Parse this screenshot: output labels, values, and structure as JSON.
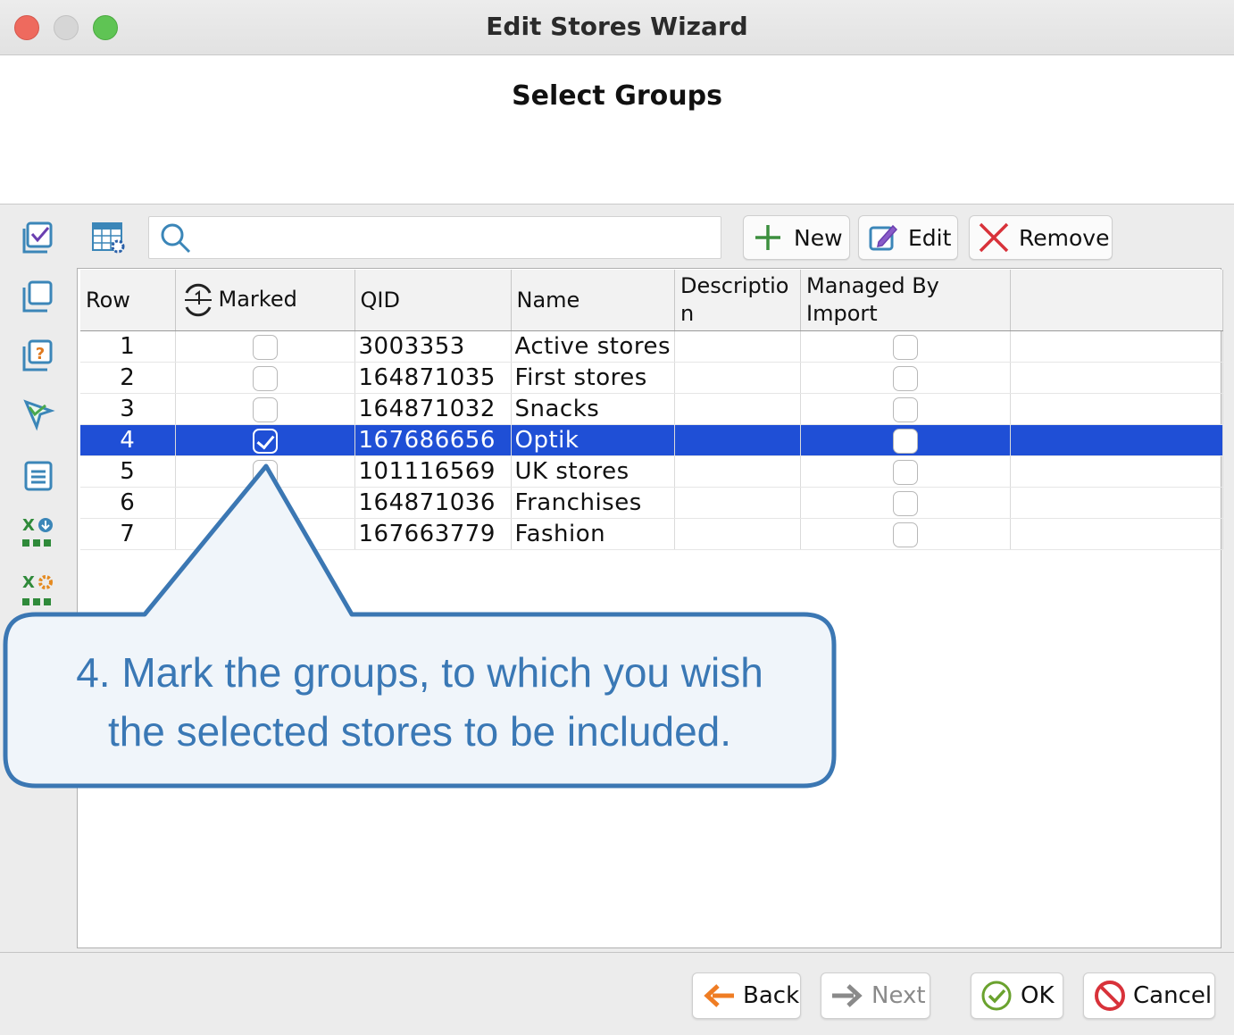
{
  "window": {
    "title": "Edit Stores Wizard"
  },
  "page": {
    "title": "Select Groups"
  },
  "search": {
    "placeholder": "",
    "value": ""
  },
  "toolbar": {
    "new_label": "New",
    "edit_label": "Edit",
    "remove_label": "Remove"
  },
  "table": {
    "columns": [
      "Row",
      "Marked",
      "QID",
      "Name",
      "Descriptio n",
      "Managed By Import"
    ],
    "rows": [
      {
        "row": "1",
        "marked": false,
        "qid": "3003353",
        "name": "Active stores",
        "description": "",
        "managed": false
      },
      {
        "row": "2",
        "marked": false,
        "qid": "164871035",
        "name": "First stores",
        "description": "",
        "managed": false
      },
      {
        "row": "3",
        "marked": false,
        "qid": "164871032",
        "name": "Snacks",
        "description": "",
        "managed": false
      },
      {
        "row": "4",
        "marked": true,
        "qid": "167686656",
        "name": "Optik",
        "description": "",
        "managed": false,
        "selected": true
      },
      {
        "row": "5",
        "marked": false,
        "qid": "101116569",
        "name": "UK stores",
        "description": "",
        "managed": false
      },
      {
        "row": "6",
        "marked": false,
        "qid": "164871036",
        "name": "Franchises",
        "description": "",
        "managed": false
      },
      {
        "row": "7",
        "marked": false,
        "qid": "167663779",
        "name": "Fashion",
        "description": "",
        "managed": false
      }
    ]
  },
  "callout": {
    "line1": "4. Mark the groups, to which you wish",
    "line2": "the selected stores to be included."
  },
  "footer": {
    "back_label": "Back",
    "next_label": "Next",
    "ok_label": "OK",
    "cancel_label": "Cancel"
  },
  "colors": {
    "selection": "#1f4fd6",
    "callout_text": "#3a78b5",
    "callout_border": "#3b77b3",
    "callout_fill": "#f0f5fa"
  },
  "icons": [
    "mark-all-icon",
    "copy-icon",
    "query-icon",
    "pointer-icon",
    "document-list-icon",
    "excel-export-icon",
    "excel-settings-icon",
    "table-settings-icon",
    "search-icon",
    "plus-icon",
    "edit-icon",
    "remove-icon",
    "back-arrow-icon",
    "next-arrow-icon",
    "ok-check-icon",
    "cancel-icon",
    "sort-icon"
  ]
}
